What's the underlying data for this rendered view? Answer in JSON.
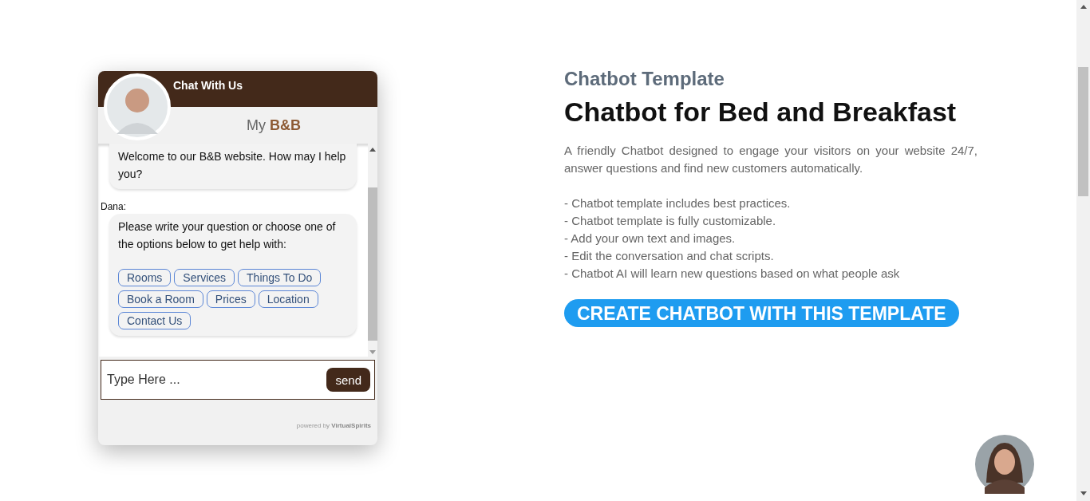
{
  "chat_widget": {
    "title": "Chat With Us",
    "brand": "My **B&B**",
    "messages": [
      {
        "text": "Welcome to our B&B website. How may I help you?"
      },
      {
        "sender": "Dana:",
        "text": "Please write your question or choose one of the options below to get help with:",
        "options": [
          "Rooms",
          "Services",
          "Things To Do",
          "Book a Room",
          "Prices",
          "Location",
          "Contact Us"
        ]
      }
    ],
    "input": {
      "placeholder": "Type Here ..."
    },
    "send_button": "send",
    "footer": "powered by **VirtualSpirits**"
  },
  "template": {
    "eyebrow": "Chatbot Template",
    "title": "Chatbot for Bed and Breakfast",
    "description": "A friendly Chatbot designed to engage your visitors on your website 24/7, answer questions and find new customers automatically.",
    "features": [
      "- Chatbot template includes best practices.",
      "- Chatbot template is fully customizable.",
      "- Add your own text and images.",
      "- Edit the conversation and chat scripts.",
      "- Chatbot AI will learn new questions based on what people ask"
    ],
    "cta": "CREATE CHATBOT WITH THIS TEMPLATE"
  }
}
